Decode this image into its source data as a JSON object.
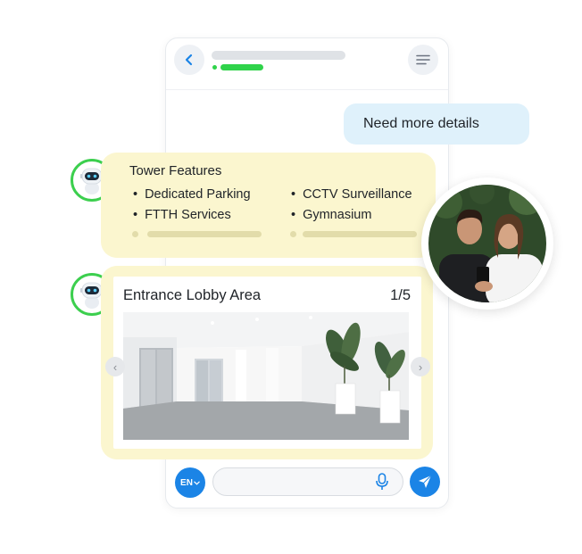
{
  "chat": {
    "user_message": "Need more details"
  },
  "features": {
    "title": "Tower Features",
    "items": [
      "Dedicated Parking",
      "FTTH Services",
      "CCTV Surveillance",
      "Gymnasium"
    ]
  },
  "lobby": {
    "title": "Entrance Lobby Area",
    "counter": "1/5"
  },
  "composer": {
    "language": "EN",
    "input_value": ""
  },
  "icons": {
    "back": "chevron-left-icon",
    "menu": "menu-icon",
    "bot": "robot-icon",
    "mic": "microphone-icon",
    "send": "send-icon",
    "language_caret": "chevron-down-icon"
  },
  "colors": {
    "accent_blue": "#1b84e6",
    "online_green": "#2fd34a",
    "avatar_ring": "#3ccf4e",
    "bot_card": "#fbf6cf",
    "user_bubble": "#dff1fb"
  }
}
